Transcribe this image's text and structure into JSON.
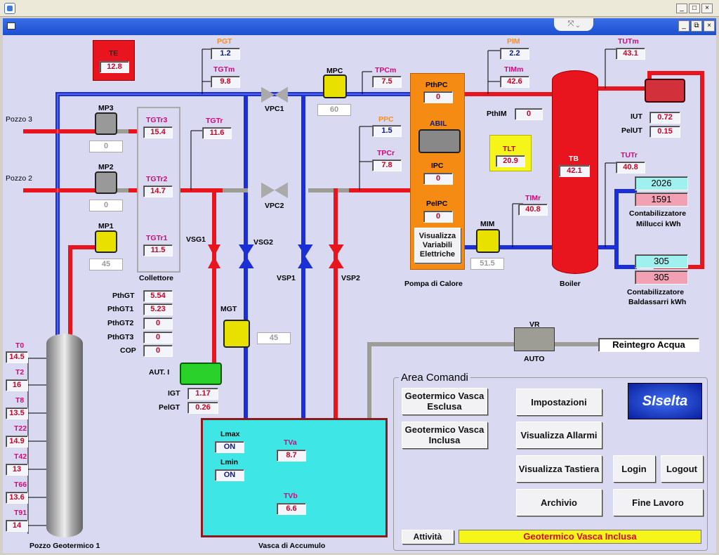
{
  "window": {
    "min": "_",
    "max": "□",
    "close": "×",
    "restore": "⧉"
  },
  "labels": {
    "pgt": "PGT",
    "tgtm": "TGTm",
    "mpc": "MPC",
    "tpcm": "TPCm",
    "pim": "PIM",
    "timm": "TIMm",
    "tutm": "TUTm",
    "pthpc": "PthPC",
    "abil": "ABIL",
    "ipc": "IPC",
    "pelpc": "PelPC",
    "pthim": "PthIM",
    "tlt": "TLT",
    "tb": "TB",
    "iut": "IUT",
    "pelut": "PelUT",
    "tutr": "TUTr",
    "vpc1": "VPC1",
    "vpc2": "VPC2",
    "ppc": "PPC",
    "tpcr": "TPCr",
    "pozzo3": "Pozzo 3",
    "pozzo2": "Pozzo 2",
    "mp3": "MP3",
    "mp2": "MP2",
    "mp1": "MP1",
    "tgtr3": "TGTr3",
    "tgtr2": "TGTr2",
    "tgtr1": "TGTr1",
    "tgtr": "TGTr",
    "collettore": "Collettore",
    "vsg1": "VSG1",
    "vsg2": "VSG2",
    "vsp1": "VSP1",
    "vsp2": "VSP2",
    "pompa": "Pompa di Calore",
    "boiler": "Boiler",
    "mim": "MIM",
    "timr": "TIMr",
    "contab1a": "Contabilizzatore",
    "contab1b": "Millucci   kWh",
    "contab2a": "Contabilizzatore",
    "contab2b": "Baldassarri kWh",
    "pthgt": "PthGT",
    "pthgt1": "PthGT1",
    "pthgt2": "PthGT2",
    "pthgt3": "PthGT3",
    "cop": "COP",
    "mgt": "MGT",
    "aut": "AUT. I",
    "igt": "IGT",
    "pelgt": "PelGT",
    "te": "TE",
    "t0": "T0",
    "t2": "T2",
    "t8": "T8",
    "t22": "T22",
    "t42": "T42",
    "t66": "T66",
    "t91": "T91",
    "pozzogeo": "Pozzo Geotermico 1",
    "vasca": "Vasca di Accumulo",
    "lmax": "Lmax",
    "lmin": "Lmin",
    "tva": "TVa",
    "tvb": "TVb",
    "vr": "VR",
    "auto": "AUTO",
    "area": "Area Comandi",
    "attivita": "Attività",
    "logo": "SIselta"
  },
  "values": {
    "te": "12.8",
    "pgt": "1.2",
    "tgtm": "9.8",
    "mpc": "60",
    "tpcm": "7.5",
    "pim": "2.2",
    "timm": "42.6",
    "tutm": "43.1",
    "pthpc": "0",
    "ipc": "0",
    "pelpc": "0",
    "pthim": "0",
    "tlt": "20.9",
    "tb": "42.1",
    "iut": "0.72",
    "pelut": "0.15",
    "tutr": "40.8",
    "ppc": "1.5",
    "tpcr": "7.8",
    "mp3": "0",
    "mp2": "0",
    "mp1": "45",
    "tgtr3": "15.4",
    "tgtr2": "14.7",
    "tgtr1": "11.5",
    "tgtr": "11.6",
    "mim": "51.5",
    "timr": "40.8",
    "c1a": "2026",
    "c1b": "1591",
    "c2a": "305",
    "c2b": "305",
    "pthgt": "5.54",
    "pthgt1": "5.23",
    "pthgt2": "0",
    "pthgt3": "0",
    "cop": "0",
    "mgt": "45",
    "igt": "1.17",
    "pelgt": "0.26",
    "t0": "14.5",
    "t2": "16",
    "t8": "13.5",
    "t22": "14.9",
    "t42": "13",
    "t66": "13.6",
    "t91": "14",
    "lmax": "ON",
    "lmin": "ON",
    "tva": "8.7",
    "tvb": "6.6",
    "reintegro": "Reintegro Acqua",
    "attivita": "Geotermico Vasca Inclusa"
  },
  "buttons": {
    "geo_esclusa": "Geotermico Vasca Esclusa",
    "geo_inclusa": "Geotermico Vasca Inclusa",
    "impostazioni": "Impostazioni",
    "allarmi": "Visualizza Allarmi",
    "tastiera": "Visualizza Tastiera",
    "archivio": "Archivio",
    "login": "Login",
    "logout": "Logout",
    "fine": "Fine Lavoro",
    "visualizza_el": "Visualizza Variabili Elettriche"
  },
  "colors": {
    "hot": "#e8141e",
    "cold": "#1b2fd6",
    "grey": "#9d9d96",
    "pump": "#e8e100",
    "water": "#3fe6e6"
  }
}
